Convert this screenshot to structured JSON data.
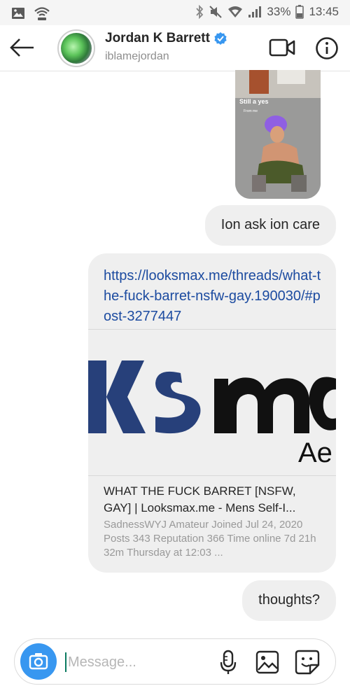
{
  "status_bar": {
    "battery_percent": "33%",
    "time": "13:45"
  },
  "header": {
    "name": "Jordan K Barrett",
    "handle": "iblamejordan",
    "verified": true
  },
  "story_reply": {
    "caption": "Still a yes",
    "subcaption": "From me"
  },
  "messages": [
    {
      "text": "Ion ask ion care"
    },
    {
      "type": "link",
      "url": "https://looksmax.me/threads/what-the-fuck-barret-nsfw-gay.190030/#post-3277447",
      "preview_logo_text": "Ae",
      "title": "WHAT THE FUCK BARRET [NSFW, GAY] | Looksmax.me - Mens Self-I...",
      "description": "SadnessWYJ Amateur Joined Jul 24, 2020 Posts 343 Reputation 366 Time online 7d 21h 32m Thursday at 12:03 ..."
    },
    {
      "text": "thoughts?"
    }
  ],
  "composer": {
    "placeholder": "Message...",
    "value": ""
  },
  "colors": {
    "accent": "#3897f0",
    "verified": "#3897f0",
    "link": "#1c4ba0",
    "bubble": "#efefef",
    "brand_blue": "#27407a"
  }
}
